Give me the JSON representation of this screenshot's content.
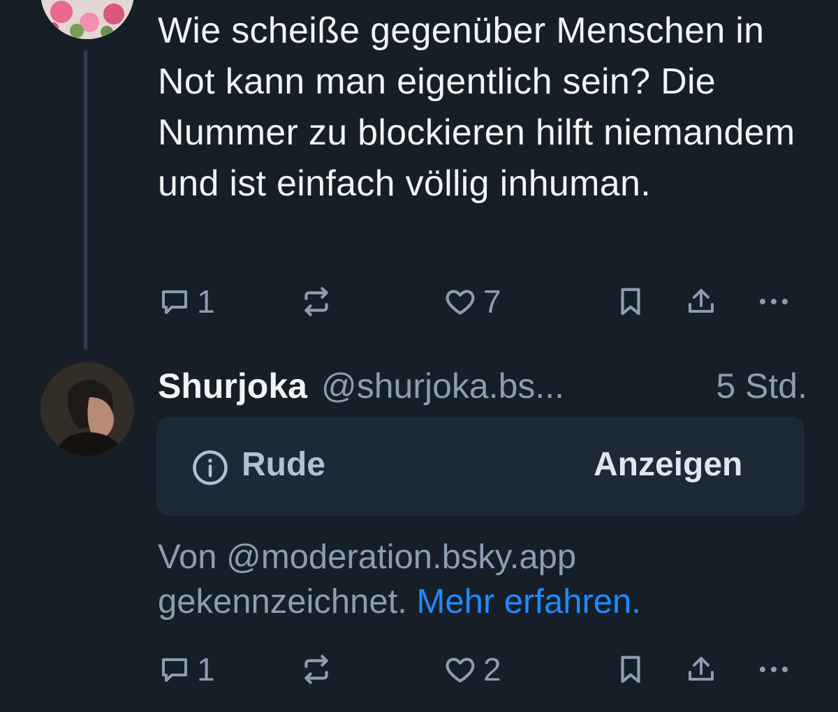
{
  "post_1": {
    "text": "Wie scheiße gegenüber Menschen in Not kann man eigentlich sein? Die Nummer zu blockieren hilft niemandem und ist einfach völlig inhuman.",
    "reply_count": "1",
    "like_count": "7"
  },
  "post_2": {
    "author_name": "Shurjoka",
    "author_handle": "@shurjoka.bs...",
    "time": "5 Std.",
    "moderation": {
      "label": "Rude",
      "show_button": "Anzeigen",
      "note_prefix": "Von @moderation.bsky.app gekennzeichnet.",
      "learn_more": "Mehr erfahren."
    },
    "reply_count": "1",
    "like_count": "2"
  },
  "colors": {
    "background": "#161e27",
    "text": "#f1f3f5",
    "muted": "#8b9db1",
    "link": "#208bfe",
    "mod_box": "#1e2937"
  },
  "icons": [
    "reply-icon",
    "repost-icon",
    "like-icon",
    "bookmark-icon",
    "share-icon",
    "more-icon",
    "info-icon"
  ]
}
